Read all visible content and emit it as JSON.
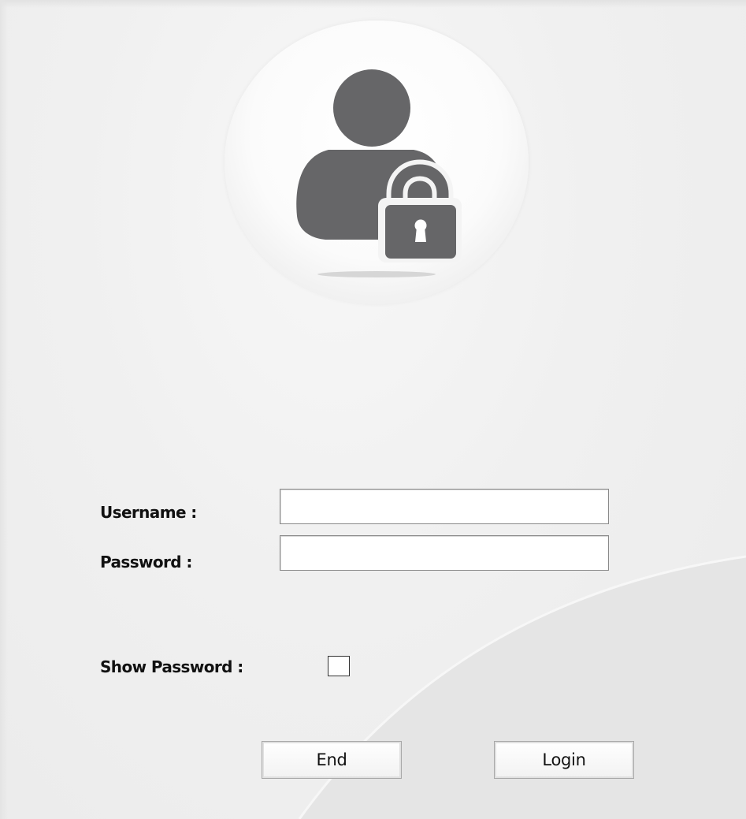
{
  "form": {
    "username_label": "Username :",
    "username_value": "",
    "password_label": "Password :",
    "password_value": "",
    "show_password_label": "Show Password :",
    "show_password_checked": false
  },
  "buttons": {
    "end_label": "End",
    "login_label": "Login"
  },
  "icons": {
    "avatar": "user-lock-icon",
    "lock": "padlock-icon"
  },
  "colors": {
    "icon": "#666668",
    "background": "#efefef",
    "field_border": "#8a8a8a"
  }
}
